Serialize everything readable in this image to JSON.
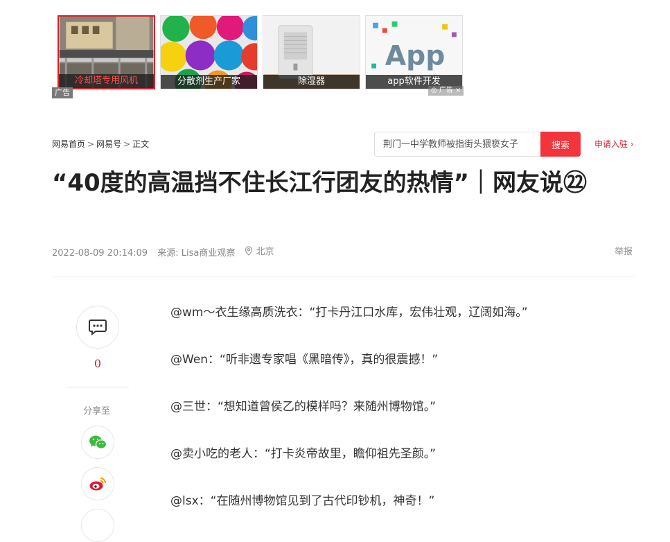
{
  "ads": [
    {
      "caption": "冷却塔专用风机"
    },
    {
      "caption": "分散剂生产厂家"
    },
    {
      "caption": "除湿器"
    },
    {
      "caption": "app软件开发"
    }
  ],
  "ad_label": "广告",
  "ad_badge": "◎ 广告 ×",
  "breadcrumb": {
    "home": "网易首页",
    "section": "网易号",
    "current": "正文",
    "separator": ">"
  },
  "search": {
    "placeholder": "荆门一中学教师被指街头猥亵女子",
    "button": "搜索"
  },
  "apply_link": "申请入驻 ›",
  "title": "“40度的高温挡不住长江行团友的热情”｜网友说㉒",
  "meta": {
    "datetime": "2022-08-09 20:14:09",
    "source": "来源: Lisa商业观察",
    "location": "北京"
  },
  "report": "举报",
  "sidebar": {
    "comment_count": "0",
    "share_label": "分享至"
  },
  "paragraphs": [
    "@wm～衣生缘高质洗衣：“打卡丹江口水库，宏伟壮观，辽阔如海。”",
    "@Wen：“听非遗专家唱《黑暗传》，真的很震撼！”",
    "@三世：“想知道曾侯乙的模样吗？来随州博物馆。”",
    "@卖小吃的老人：“打卡炎帝故里，瞻仰祖先圣颜。”",
    "@lsx：“在随州博物馆见到了古代印钞机，神奇！”"
  ],
  "colors": {
    "accent": "#f4343b",
    "link_red": "#d0202c"
  }
}
